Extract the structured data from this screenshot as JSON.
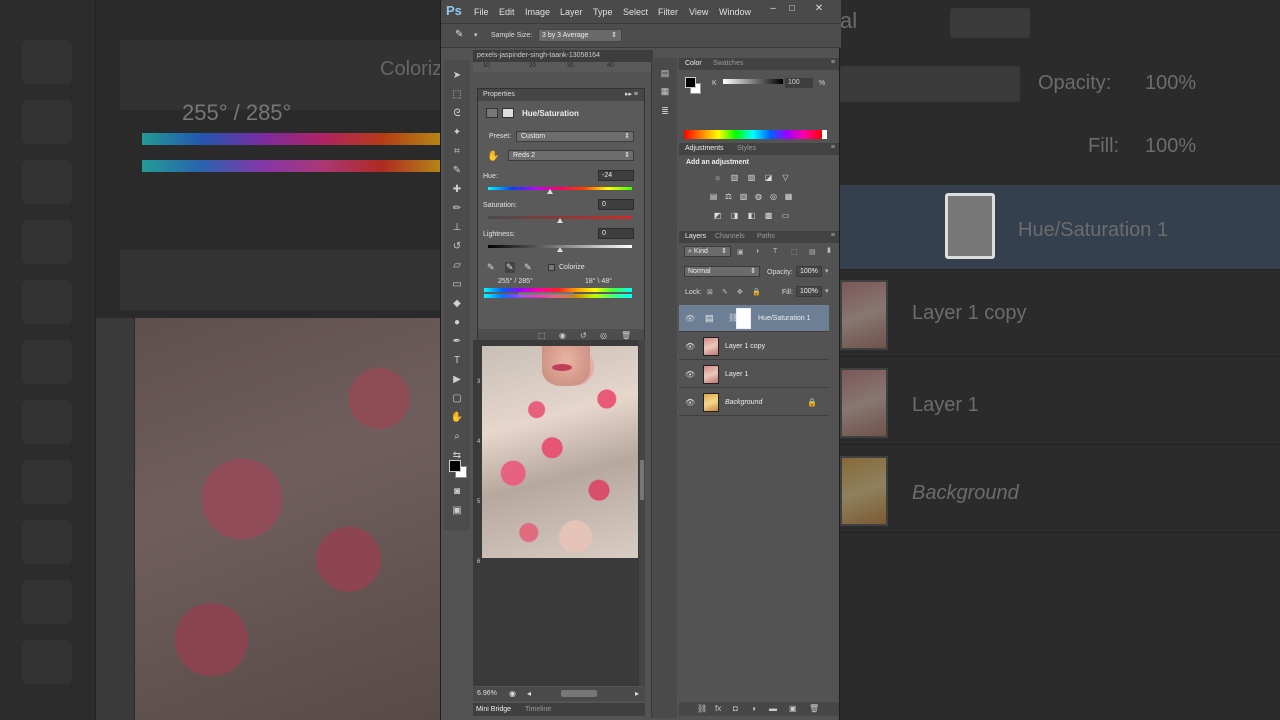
{
  "app": {
    "logo": "Ps"
  },
  "menu": [
    "File",
    "Edit",
    "Image",
    "Layer",
    "Type",
    "Select",
    "Filter",
    "View",
    "Window"
  ],
  "window_controls": {
    "minimize": "–",
    "maximize": "□",
    "close": "✕"
  },
  "options_bar": {
    "sample_size_label": "Sample Size:",
    "sample_size_value": "3 by 3 Average"
  },
  "document": {
    "tab_title": "pexels-jaspinder-singh-taank-13058164",
    "ruler_ticks": [
      "10",
      "20",
      "30",
      "40"
    ],
    "vertical_ruler": [
      "3",
      "4",
      "5",
      "6"
    ],
    "zoom": "6.96%"
  },
  "properties": {
    "panel_title": "Properties",
    "adjustment_title": "Hue/Saturation",
    "preset_label": "Preset:",
    "preset_value": "Custom",
    "channel_value": "Reds 2",
    "hue_label": "Hue:",
    "hue_value": "-24",
    "hue_level": -24,
    "saturation_label": "Saturation:",
    "saturation_value": "0",
    "lightness_label": "Lightness:",
    "lightness_value": "0",
    "colorize_label": "Colorize",
    "range_left": "255° / 285°",
    "range_right": "18° \\ 48°"
  },
  "bottom_tabs": {
    "mini_bridge": "Mini Bridge",
    "timeline": "Timeline"
  },
  "color_panel": {
    "tabs": [
      "Color",
      "Swatches"
    ],
    "k_label": "K",
    "k_value": "100",
    "k_unit": "%"
  },
  "adjustments_panel": {
    "tabs": [
      "Adjustments",
      "Styles"
    ],
    "heading": "Add an adjustment"
  },
  "layers_panel": {
    "tabs": [
      "Layers",
      "Channels",
      "Paths"
    ],
    "kind_label": "Kind",
    "blend_mode": "Normal",
    "opacity_label": "Opacity:",
    "opacity_value": "100%",
    "lock_label": "Lock:",
    "fill_label": "Fill:",
    "fill_value": "100%",
    "layers": [
      {
        "name": "Hue/Saturation 1"
      },
      {
        "name": "Layer 1 copy"
      },
      {
        "name": "Layer 1"
      },
      {
        "name": "Background"
      }
    ]
  },
  "background_echo": {
    "angle_text": "255° / 285°",
    "colorize_text": "Coloriz",
    "blend_text": "al",
    "opacity_label": "Opacity:",
    "opacity_value": "100%",
    "fill_label": "Fill:",
    "fill_value": "100%",
    "layer_names": [
      "Hue/Saturation 1",
      "Layer 1 copy",
      "Layer 1",
      "Background"
    ]
  }
}
